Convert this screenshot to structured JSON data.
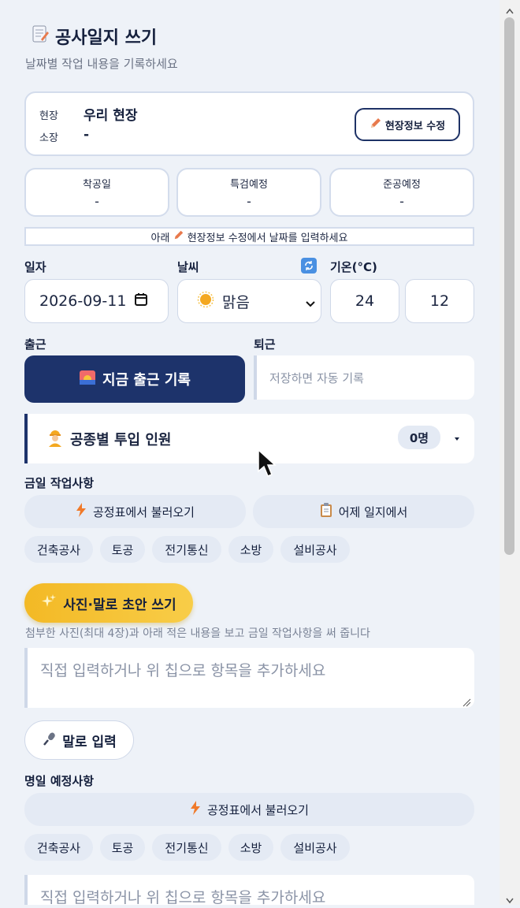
{
  "header": {
    "icon": "memo-icon",
    "title": "공사일지 쓰기",
    "subtitle": "날짜별 작업 내용을 기록하세요"
  },
  "site": {
    "site_label": "현장",
    "site_value": "우리 현장",
    "manager_label": "소장",
    "manager_value": "-",
    "edit_button": "현장정보 수정"
  },
  "dates": [
    {
      "label": "착공일",
      "value": "-"
    },
    {
      "label": "특검예정",
      "value": "-"
    },
    {
      "label": "준공예정",
      "value": "-"
    }
  ],
  "hint": {
    "prefix": "아래",
    "link": "현장정보 수정에서 날짜를 입력하세요"
  },
  "fields": {
    "date_label": "일자",
    "date_value": "2026-09-11",
    "weather_label": "날씨",
    "weather_value": "맑음",
    "temp_label": "기온(°C)",
    "temp_high": "24",
    "temp_low": "12"
  },
  "attendance": {
    "checkin_label": "출근",
    "checkin_button": "지금 출근 기록",
    "checkout_label": "퇴근",
    "checkout_placeholder": "저장하면 자동 기록"
  },
  "workers": {
    "title": "공종별 투입 인원",
    "count": "0명"
  },
  "today": {
    "label": "금일 작업사항",
    "load_schedule": "공정표에서 불러오기",
    "load_yesterday": "어제 일지에서",
    "chips": [
      "건축공사",
      "토공",
      "전기통신",
      "소방",
      "설비공사"
    ],
    "ai_button": "사진·말로 초안 쓰기",
    "ai_note": "첨부한 사진(최대 4장)과 아래 적은 내용을 보고 금일 작업사항을 써 줍니다",
    "placeholder": "직접 입력하거나 위 칩으로 항목을 추가하세요",
    "voice_button": "말로 입력"
  },
  "tomorrow": {
    "label": "명일 예정사항",
    "load_schedule": "공정표에서 불러오기",
    "chips": [
      "건축공사",
      "토공",
      "전기통신",
      "소방",
      "설비공사"
    ],
    "placeholder": "직접 입력하거나 위 칩으로 항목을 추가하세요"
  },
  "colors": {
    "primary": "#1d336b",
    "accent": "#f3b925",
    "background": "#eef2f8"
  }
}
